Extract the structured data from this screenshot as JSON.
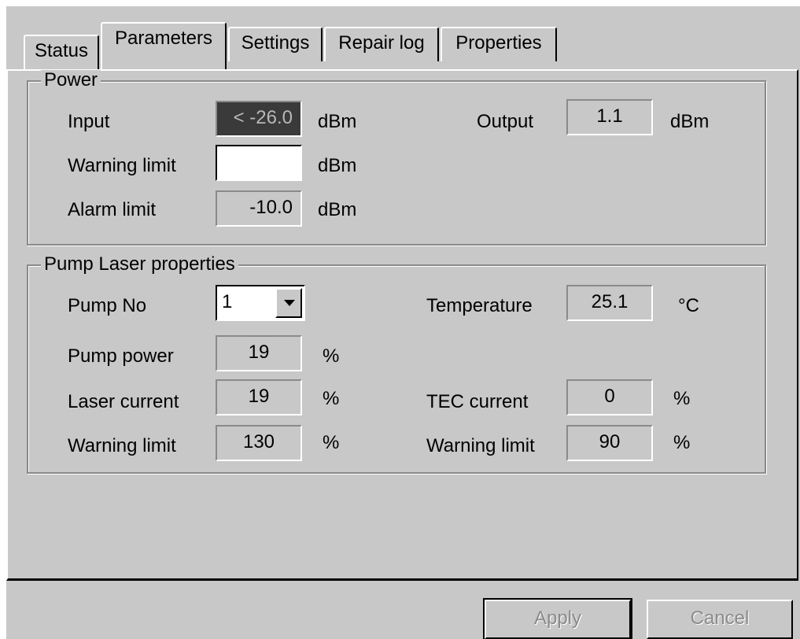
{
  "tabs": [
    "Status",
    "Parameters",
    "Settings",
    "Repair log",
    "Properties"
  ],
  "active_tab": "Parameters",
  "power": {
    "title": "Power",
    "input_label": "Input",
    "input_value": "< -26.0",
    "input_unit": "dBm",
    "output_label": "Output",
    "output_value": "1.1",
    "output_unit": "dBm",
    "warning_label": "Warning limit",
    "warning_value": "",
    "warning_unit": "dBm",
    "alarm_label": "Alarm limit",
    "alarm_value": "-10.0",
    "alarm_unit": "dBm"
  },
  "pump": {
    "title": "Pump Laser properties",
    "pump_no_label": "Pump No",
    "pump_no_value": "1",
    "temperature_label": "Temperature",
    "temperature_value": "25.1",
    "temperature_unit": "°C",
    "pump_power_label": "Pump power",
    "pump_power_value": "19",
    "pump_power_unit": "%",
    "laser_current_label": "Laser current",
    "laser_current_value": "19",
    "laser_current_unit": "%",
    "tec_current_label": "TEC current",
    "tec_current_value": "0",
    "tec_current_unit": "%",
    "laser_warning_label": "Warning limit",
    "laser_warning_value": "130",
    "laser_warning_unit": "%",
    "tec_warning_label": "Warning limit",
    "tec_warning_value": "90",
    "tec_warning_unit": "%"
  },
  "buttons": {
    "apply": "Apply",
    "cancel": "Cancel"
  },
  "icons": {
    "dropdown": "chevron-down-icon"
  }
}
